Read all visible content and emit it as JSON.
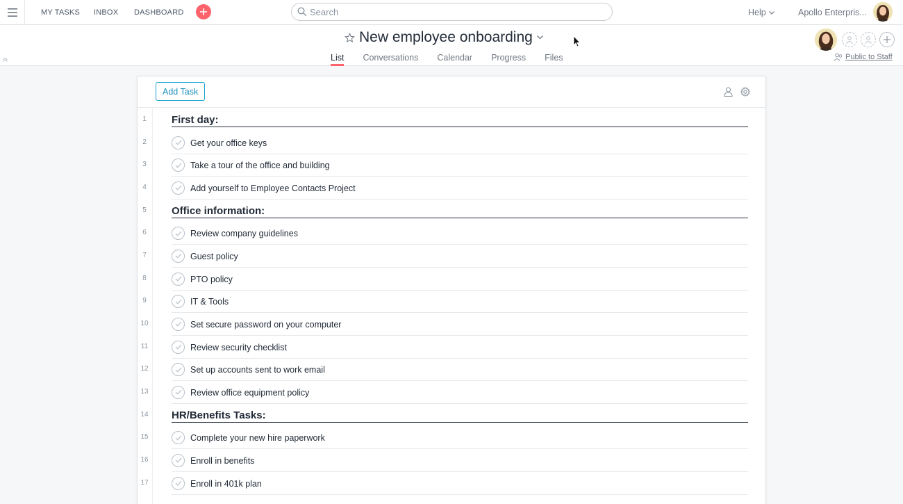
{
  "topbar": {
    "nav": [
      {
        "label": "MY TASKS"
      },
      {
        "label": "INBOX"
      },
      {
        "label": "DASHBOARD"
      }
    ],
    "search_placeholder": "Search",
    "help_label": "Help",
    "org_label": "Apollo Enterpris..."
  },
  "project": {
    "title": "New employee onboarding",
    "tabs": [
      {
        "label": "List",
        "active": true
      },
      {
        "label": "Conversations",
        "active": false
      },
      {
        "label": "Calendar",
        "active": false
      },
      {
        "label": "Progress",
        "active": false
      },
      {
        "label": "Files",
        "active": false
      }
    ],
    "privacy_label": "Public to Staff"
  },
  "toolbar": {
    "add_task_label": "Add Task"
  },
  "rows": [
    {
      "num": "1",
      "type": "section",
      "name": "First day:"
    },
    {
      "num": "2",
      "type": "task",
      "name": "Get your office keys"
    },
    {
      "num": "3",
      "type": "task",
      "name": "Take a tour of the office and building"
    },
    {
      "num": "4",
      "type": "task",
      "name": "Add yourself to Employee Contacts Project"
    },
    {
      "num": "5",
      "type": "section",
      "name": "Office information:"
    },
    {
      "num": "6",
      "type": "task",
      "name": "Review company guidelines"
    },
    {
      "num": "7",
      "type": "task",
      "name": "Guest policy"
    },
    {
      "num": "8",
      "type": "task",
      "name": "PTO policy"
    },
    {
      "num": "9",
      "type": "task",
      "name": "IT & Tools"
    },
    {
      "num": "10",
      "type": "task",
      "name": "Set secure password on your computer"
    },
    {
      "num": "11",
      "type": "task",
      "name": "Review security checklist"
    },
    {
      "num": "12",
      "type": "task",
      "name": "Set up accounts sent to work email"
    },
    {
      "num": "13",
      "type": "task",
      "name": "Review office equipment policy"
    },
    {
      "num": "14",
      "type": "section",
      "name": "HR/Benefits Tasks:"
    },
    {
      "num": "15",
      "type": "task",
      "name": "Complete your new hire paperwork"
    },
    {
      "num": "16",
      "type": "task",
      "name": "Enroll in benefits"
    },
    {
      "num": "17",
      "type": "task",
      "name": "Enroll in 401k plan"
    }
  ],
  "colors": {
    "accent": "#fc636b",
    "link_blue": "#19a1cf",
    "text": "#222b37",
    "muted": "#6f7782"
  },
  "icons": [
    "hamburger-icon",
    "plus-icon",
    "search-icon",
    "chevron-down-icon",
    "star-icon",
    "person-icon",
    "gear-icon",
    "check-icon",
    "avatar-icon",
    "cursor-icon"
  ]
}
